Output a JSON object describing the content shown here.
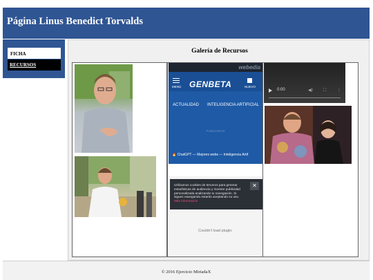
{
  "header": {
    "title": "Página Linus Benedict Torvalds"
  },
  "sidebar": {
    "items": [
      {
        "label": "FICHA"
      },
      {
        "label": "RECURSOS"
      }
    ]
  },
  "main": {
    "gallery_title": "Galería de Recursos"
  },
  "embed": {
    "top_brand": "webedia",
    "menu_label": "MENÚ",
    "brand": "GENBETA",
    "news_label": "NUEVO",
    "tabs": [
      "ACTUALIDAD",
      "INTELIGENCIA ARTIFICIAL"
    ],
    "ad_label": "PUBLICIDAD",
    "trending": [
      "ChatGPT",
      "Mejores webs",
      "Inteligencia Artif"
    ],
    "cookie_text": "Utilizamos cookies de terceros para generar estadísticas de audiencia y mostrar publicidad personalizada analizando tu navegación. Si sigues navegando estarás aceptando su uso.",
    "cookie_more": "Más información",
    "cookie_close": "✕",
    "plugin_message": "Couldn't load plugin."
  },
  "video": {
    "time": "0:00",
    "volume_icon": "volume-icon",
    "fullscreen_icon": "fullscreen-icon",
    "more_icon": "more-icon"
  },
  "footer": {
    "text": "© 2016 Ejercicio MiriadaX"
  }
}
